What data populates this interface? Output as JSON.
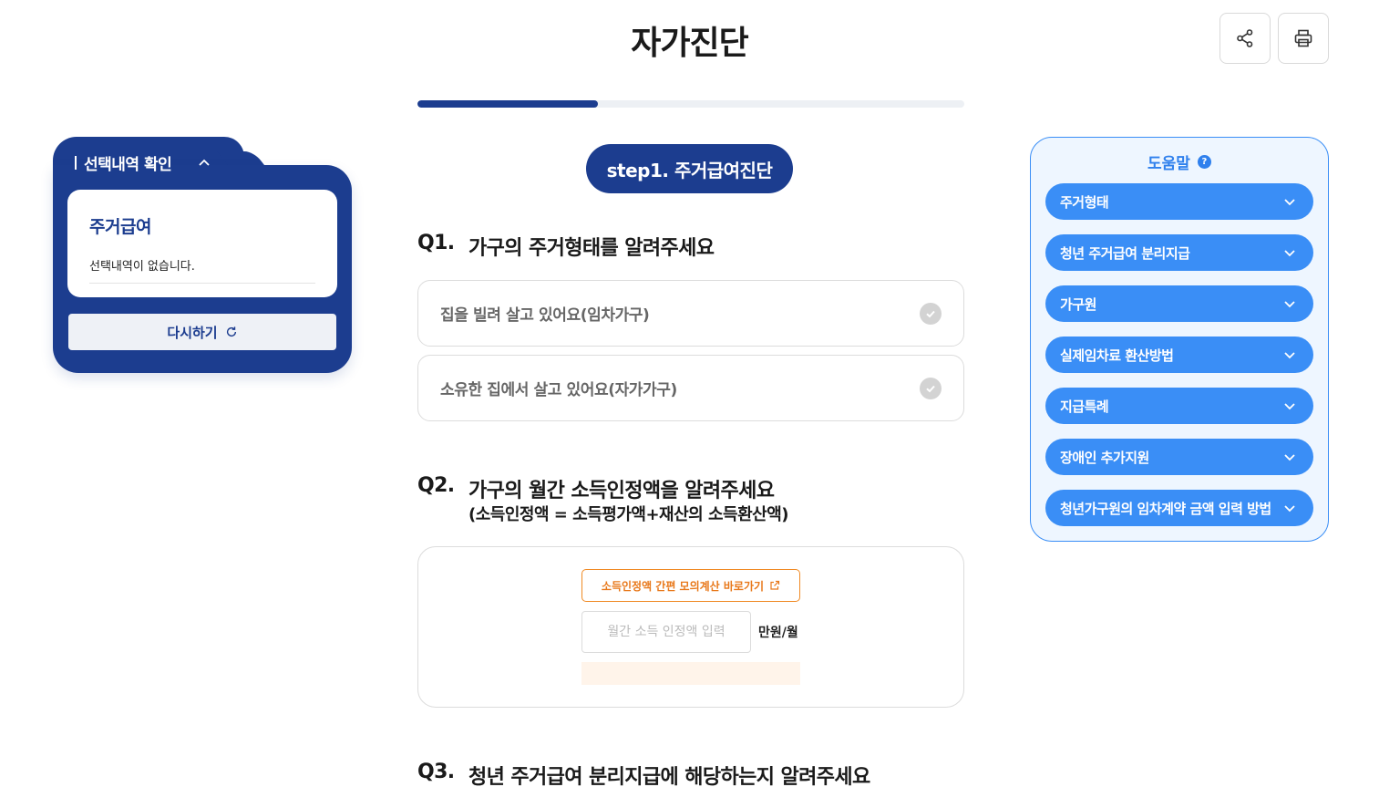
{
  "header": {
    "title": "자가진단"
  },
  "toolbar": {
    "share_icon": "share-icon",
    "print_icon": "print-icon"
  },
  "progress": {
    "fraction": 0.33
  },
  "selection": {
    "heading": "선택내역 확인",
    "card_title": "주거급여",
    "empty_text": "선택내역이 없습니다.",
    "retry_label": "다시하기"
  },
  "step": {
    "label": "step1. 주거급여진단"
  },
  "q1": {
    "number": "Q1.",
    "text": "가구의 주거형태를 알려주세요",
    "options": [
      {
        "label": "집을 빌려 살고 있어요(임차가구)"
      },
      {
        "label": "소유한 집에서 살고 있어요(자가가구)"
      }
    ]
  },
  "q2": {
    "number": "Q2.",
    "text": "가구의 월간 소득인정액을 알려주세요",
    "subtext": "(소득인정액 = 소득평가액+재산의 소득환산액)",
    "calc_link": "소득인정액 간편 모의계산 바로가기",
    "input_placeholder": "월간 소득 인정액 입력",
    "input_value": "",
    "unit": "만원/월"
  },
  "q3": {
    "number": "Q3.",
    "text": "청년 주거급여 분리지급에 해당하는지 알려주세요"
  },
  "help": {
    "title": "도움말",
    "items": [
      {
        "label": "주거형태"
      },
      {
        "label": "청년 주거급여 분리지급"
      },
      {
        "label": "가구원"
      },
      {
        "label": "실제임차료 환산방법"
      },
      {
        "label": "지급특례"
      },
      {
        "label": "장애인 추가지원"
      },
      {
        "label": "청년가구원의 임차계약 금액 입력 방법"
      }
    ]
  },
  "colors": {
    "primary": "#1c3d8f",
    "accent": "#3a8ef6",
    "orange": "#f08a24"
  }
}
